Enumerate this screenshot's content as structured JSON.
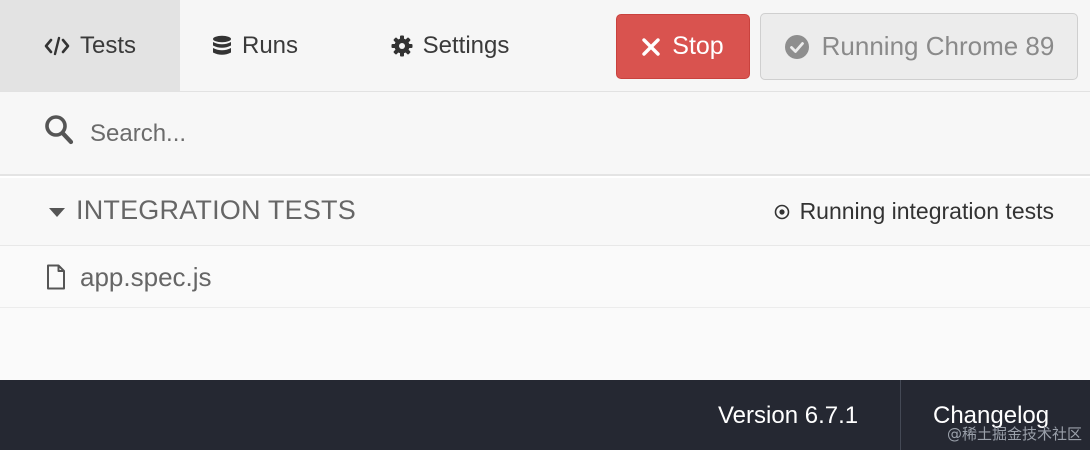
{
  "nav": {
    "tabs": [
      {
        "label": "Tests",
        "icon": "code-icon",
        "active": true
      },
      {
        "label": "Runs",
        "icon": "database-icon",
        "active": false
      },
      {
        "label": "Settings",
        "icon": "gear-icon",
        "active": false
      }
    ],
    "stop_label": "Stop",
    "browser_label": "Running Chrome 89"
  },
  "search": {
    "placeholder": "Search...",
    "value": ""
  },
  "specs": {
    "group_title": "INTEGRATION TESTS",
    "group_status": "Running integration tests",
    "files": [
      {
        "name": "app.spec.js",
        "icon": "file-icon"
      }
    ]
  },
  "footer": {
    "version": "Version 6.7.1",
    "changelog": "Changelog",
    "watermark": "@稀土掘金技术社区"
  },
  "colors": {
    "stop": "#d9534f",
    "footer_bg": "#252832",
    "active_tab_bg": "#e3e3e3"
  }
}
